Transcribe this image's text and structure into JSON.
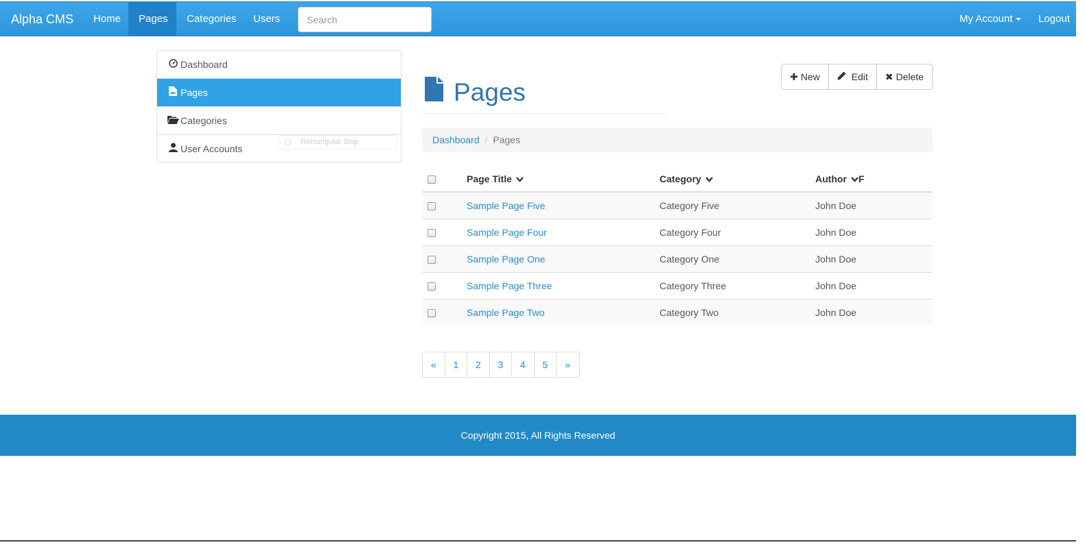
{
  "navbar": {
    "brand": "Alpha CMS",
    "items": [
      {
        "label": "Home",
        "active": false
      },
      {
        "label": "Pages",
        "active": true
      },
      {
        "label": "Categories",
        "active": false
      },
      {
        "label": "Users",
        "active": false
      }
    ],
    "search_placeholder": "Search",
    "account_label": "My Account",
    "logout_label": "Logout"
  },
  "sidebar": {
    "items": [
      {
        "label": "Dashboard",
        "icon": "dashboard-icon",
        "active": false
      },
      {
        "label": "Pages",
        "icon": "page-icon",
        "active": true
      },
      {
        "label": "Categories",
        "icon": "folder-open-icon",
        "active": false
      },
      {
        "label": "User Accounts",
        "icon": "user-icon",
        "active": false
      }
    ],
    "overlay_text": "Rectangular Snip"
  },
  "header": {
    "title": "Pages",
    "icon": "file-icon",
    "accent_color": "#3276b1"
  },
  "toolbar": {
    "new_label": "New",
    "edit_label": "Edit",
    "delete_label": "Delete"
  },
  "breadcrumb": {
    "link": "Dashboard",
    "current": "Pages"
  },
  "table": {
    "headers": [
      "Page Title",
      "Category",
      "Author"
    ],
    "author_header_suffix": "F",
    "rows": [
      {
        "title": "Sample Page Five",
        "category": "Category Five",
        "author": "John Doe"
      },
      {
        "title": "Sample Page Four",
        "category": "Category Four",
        "author": "John Doe"
      },
      {
        "title": "Sample Page One",
        "category": "Category One",
        "author": "John Doe"
      },
      {
        "title": "Sample Page Three",
        "category": "Category Three",
        "author": "John Doe"
      },
      {
        "title": "Sample Page Two",
        "category": "Category Two",
        "author": "John Doe"
      }
    ]
  },
  "pagination": {
    "prev": "«",
    "pages": [
      "1",
      "2",
      "3",
      "4",
      "5"
    ],
    "next": "»"
  },
  "footer": {
    "text": "Copyright 2015, All Rights Reserved"
  },
  "colors": {
    "navbar": "#3ea5e9",
    "active_nav": "#1f82c9",
    "sidebar_active": "#2fa3e6",
    "link": "#2a8bd3",
    "footer": "#2089c6"
  }
}
